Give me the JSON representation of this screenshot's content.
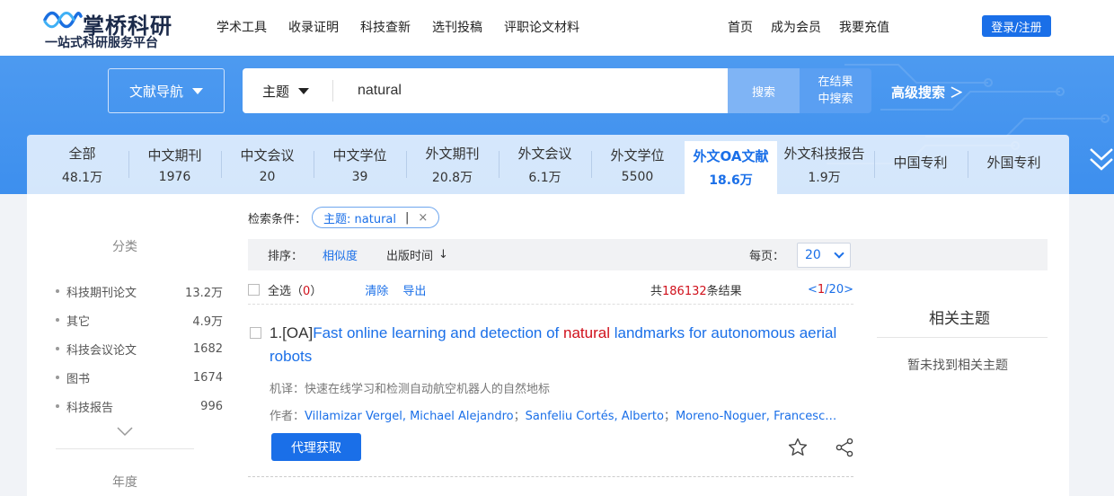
{
  "header": {
    "logo_title": "掌桥科研",
    "logo_subtitle": "一站式科研服务平台",
    "nav": [
      "学术工具",
      "收录证明",
      "科技查新",
      "选刊投稿",
      "评职论文材料"
    ],
    "right_nav": [
      "首页",
      "成为会员",
      "我要充值"
    ],
    "login_label": "登录/注册"
  },
  "search": {
    "nav_button": "文献导航",
    "scope": "主题",
    "query": "natural",
    "search_label": "搜索",
    "search_in_line1": "在结果",
    "search_in_line2": "中搜索",
    "advanced": "高级搜索 ＞"
  },
  "tabs": [
    {
      "name": "全部",
      "count": "48.1万"
    },
    {
      "name": "中文期刊",
      "count": "1976"
    },
    {
      "name": "中文会议",
      "count": "20"
    },
    {
      "name": "中文学位",
      "count": "39"
    },
    {
      "name": "外文期刊",
      "count": "20.8万"
    },
    {
      "name": "外文会议",
      "count": "6.1万"
    },
    {
      "name": "外文学位",
      "count": "5500"
    },
    {
      "name": "外文OA文献",
      "count": "18.6万"
    },
    {
      "name": "外文科技报告",
      "count": "1.9万"
    },
    {
      "name": "中国专利",
      "count": ""
    },
    {
      "name": "外国专利",
      "count": ""
    }
  ],
  "active_tab_index": 7,
  "sidebar": {
    "category_title": "分类",
    "categories": [
      {
        "name": "科技期刊论文",
        "count": "13.2万"
      },
      {
        "name": "其它",
        "count": "4.9万"
      },
      {
        "name": "科技会议论文",
        "count": "1682"
      },
      {
        "name": "图书",
        "count": "1674"
      },
      {
        "name": "科技报告",
        "count": "996"
      }
    ],
    "year_title": "年度"
  },
  "criteria": {
    "label": "检索条件：",
    "chip": "主题: natural",
    "chip_bar": "|",
    "chip_close": "×"
  },
  "sort": {
    "label": "排序：",
    "similarity": "相似度",
    "pub_time": "出版时间",
    "pub_arrow": "↓",
    "per_page_label": "每页：",
    "per_page_value": "20"
  },
  "actions": {
    "select_all": "全选",
    "selected_open": "（",
    "selected_count": "0",
    "selected_close": "）",
    "clear": "清除",
    "export": "导出",
    "total_prefix": "共",
    "total_count": "186132",
    "total_suffix": "条结果",
    "pager_prev": "<",
    "pager_current": "1",
    "pager_rest": "/20>"
  },
  "result": {
    "index": "1.[OA]",
    "title_before": "Fast online learning and detection of ",
    "title_highlight": "natural",
    "title_after": " landmarks for autonomous aerial robots",
    "translation": "机译：快速在线学习和检测自动航空机器人的自然地标",
    "authors_label": "作者：",
    "authors": [
      "Villamizar Vergel, Michael Alejandro",
      "Sanfeliu Cortés, Alberto",
      "Moreno-Noguer, Francesc…"
    ],
    "author_sep": "；",
    "get_button": "代理获取"
  },
  "related": {
    "title": "相关主题",
    "empty": "暂未找到相关主题"
  },
  "colors": {
    "brand_blue": "#1a6fe8",
    "band_blue": "#4d9af0",
    "highlight_red": "#d0101b"
  }
}
